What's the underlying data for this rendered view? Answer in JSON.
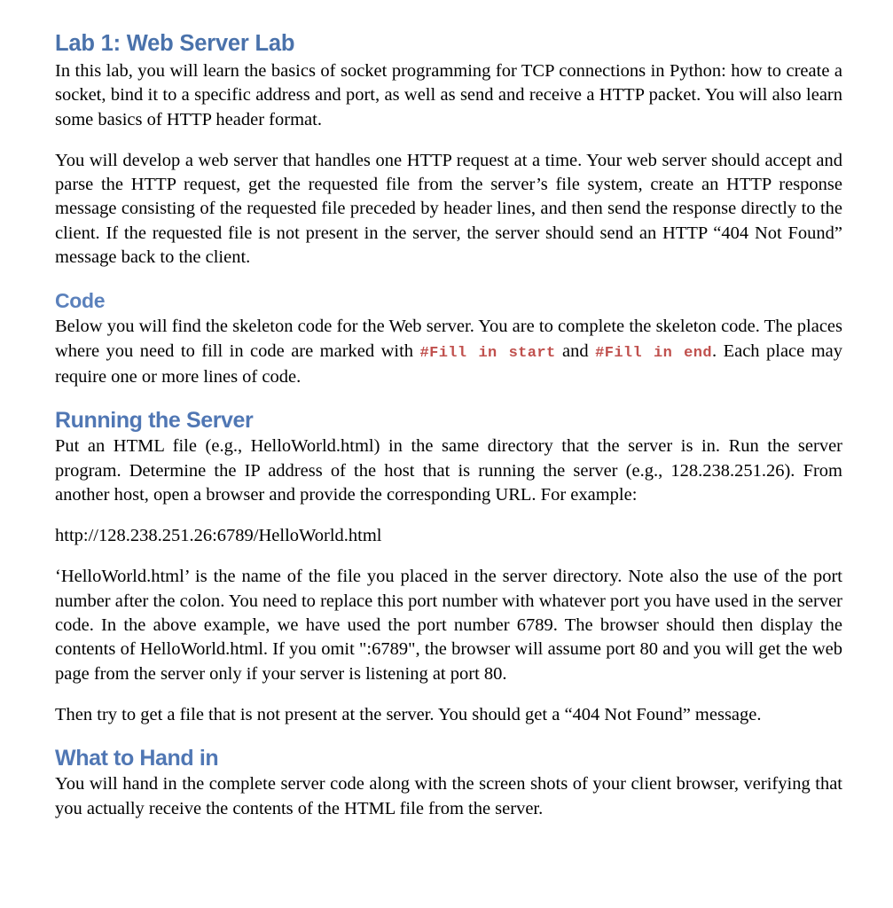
{
  "document": {
    "title": "Lab 1: Web Server Lab",
    "colors": {
      "heading_blue": "#4a72ab",
      "section_blue": "#5b81bc",
      "inline_code_red": "#c0504d",
      "body_text": "#000000",
      "page_background": "#ffffff"
    }
  },
  "sections": {
    "intro": {
      "heading": "Lab 1: Web Server Lab",
      "paragraph_1": "In this lab, you will learn the basics of socket programming for TCP connections in Python: how to create a socket, bind it to a specific address and port, as well as send and receive a HTTP packet. You will also learn some basics of HTTP header format.",
      "paragraph_2": "You will develop a web server that handles one HTTP request at a time. Your web server should accept and parse the HTTP request, get the requested file from the server’s file system, create an HTTP response message consisting of the requested file preceded by header lines, and then send the response directly to the client. If the requested file is not present in the server, the server should send an HTTP “404 Not Found” message back to the client."
    },
    "code": {
      "heading": "Code",
      "paragraph_part_1": "Below you will find the skeleton code for the Web server. You are to complete the skeleton code. The places where you need to fill in code are marked with ",
      "inline_code_1": "#Fill in start",
      "paragraph_part_2": " and ",
      "inline_code_2": "#Fill in end",
      "paragraph_part_3": ". Each place may require one or more lines of code."
    },
    "running_the_server": {
      "heading": "Running the Server",
      "paragraph_1": "Put an HTML file (e.g., HelloWorld.html) in the same directory that the server is in. Run the server program. Determine the IP address of the host that is running the server (e.g., 128.238.251.26). From another host, open a browser and provide the corresponding URL. For example:",
      "example_url": "http://128.238.251.26:6789/HelloWorld.html",
      "paragraph_2": "‘HelloWorld.html’ is the name of the file you placed in the server directory. Note also the use of the port number after the colon. You need to replace this port number with whatever port you have used in the server code. In the above example, we have used the port number 6789. The browser should then display the contents of HelloWorld.html. If you omit \":6789\", the browser will assume port 80 and you will get the web page from the server only if your server is listening at port 80.",
      "paragraph_3": "Then try to get a file that is not present at the server. You should get a “404 Not Found” message."
    },
    "what_to_hand_in": {
      "heading": "What to Hand in",
      "paragraph_1": "You will hand in the complete server code along with the screen shots of your client browser, verifying that you actually receive the contents of the HTML file from the server."
    }
  }
}
